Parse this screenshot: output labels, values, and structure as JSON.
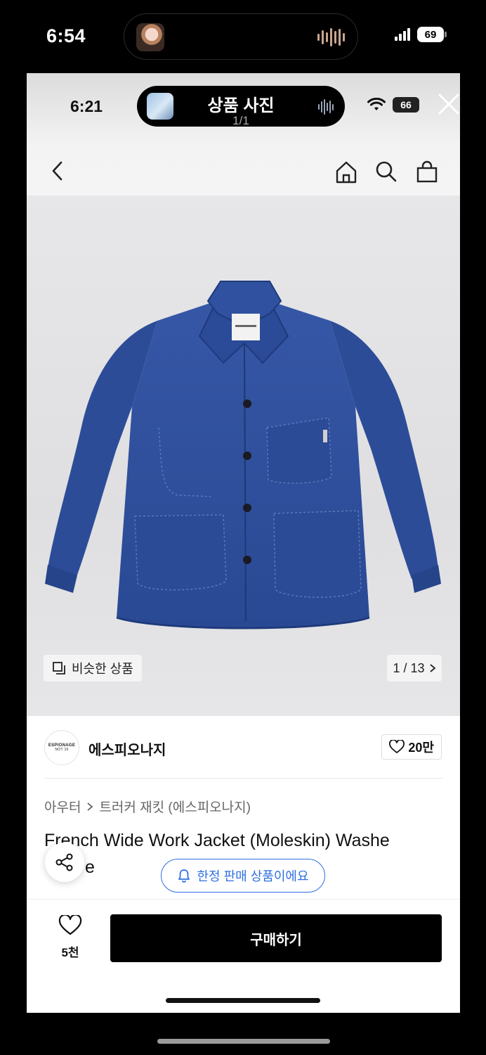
{
  "outer_status": {
    "time": "6:54",
    "battery": "69"
  },
  "inner_status": {
    "time": "6:21",
    "island_title": "상품 사진",
    "island_sub": "1/1",
    "battery": "66"
  },
  "nav": {
    "icons": [
      "back-icon",
      "home-icon",
      "search-icon",
      "bag-icon"
    ]
  },
  "gallery": {
    "similar_label": "비슷한 상품",
    "counter": "1 / 13"
  },
  "brand": {
    "logo_text": "ESPIONAGE",
    "logo_subtext": "NOT 16",
    "name": "에스피오나지",
    "likes": "20만"
  },
  "product": {
    "breadcrumb_category": "아우터",
    "breadcrumb_sub": "트러커 재킷 (에스피오나지)",
    "name_line1": "French Wide Work Jacket (Moleskin) Washe",
    "name_line2": "e",
    "limited_label": "한정 판매 상품이에요"
  },
  "bottom": {
    "wish_count": "5천",
    "buy_label": "구매하기"
  },
  "colors": {
    "jacket_blue": "#2e4f9c",
    "accent_blue": "#2f6fe0",
    "buy_button": "#000000"
  }
}
